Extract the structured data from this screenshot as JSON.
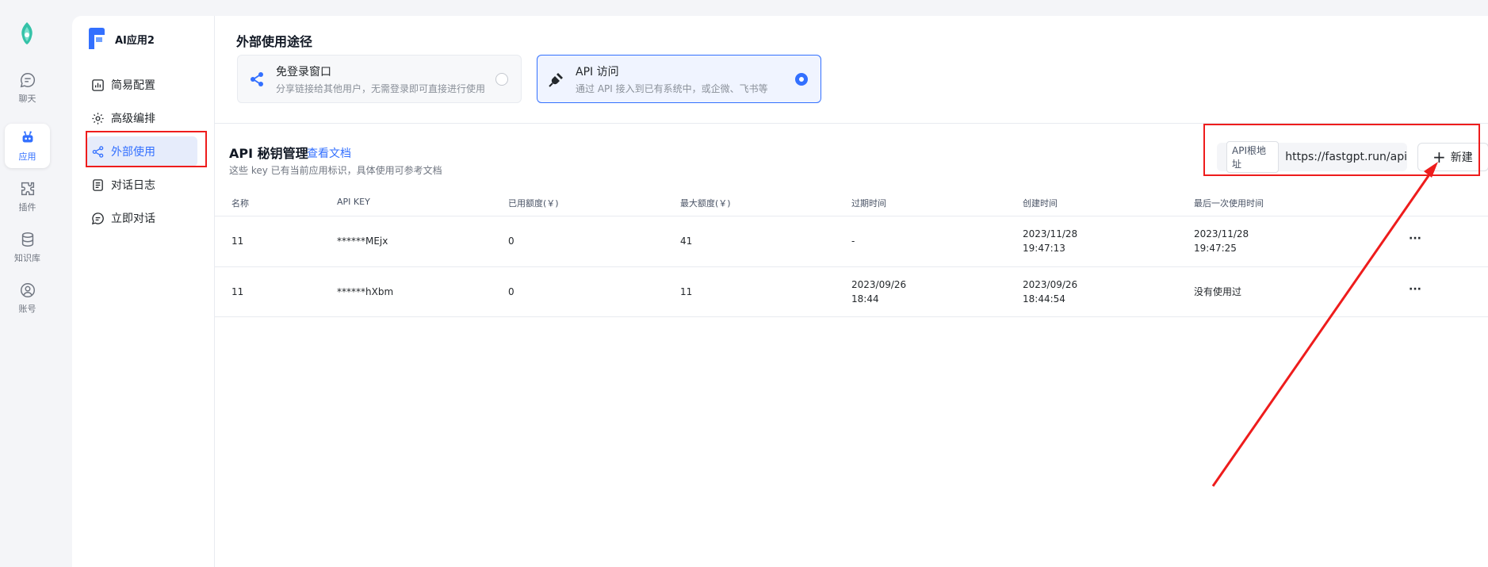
{
  "rail": {
    "items": [
      {
        "label": "聊天",
        "icon": "chat-icon"
      },
      {
        "label": "应用",
        "icon": "robot-icon"
      },
      {
        "label": "插件",
        "icon": "puzzle-icon"
      },
      {
        "label": "知识库",
        "icon": "database-icon"
      },
      {
        "label": "账号",
        "icon": "user-icon"
      }
    ]
  },
  "app": {
    "name": "AI应用2",
    "menu": [
      {
        "label": "简易配置",
        "icon": "chart-icon"
      },
      {
        "label": "高级编排",
        "icon": "gear-icon"
      },
      {
        "label": "外部使用",
        "icon": "share-icon"
      },
      {
        "label": "对话日志",
        "icon": "log-icon"
      },
      {
        "label": "立即对话",
        "icon": "chat-icon"
      }
    ]
  },
  "usage": {
    "section_title": "外部使用途径",
    "cards": [
      {
        "title": "免登录窗口",
        "desc": "分享链接给其他用户，无需登录即可直接进行使用",
        "icon": "share-icon",
        "selected": false
      },
      {
        "title": "API 访问",
        "desc": "通过 API 接入到已有系统中，或企微、飞书等",
        "icon": "plug-icon",
        "selected": true
      }
    ]
  },
  "api": {
    "title": "API 秘钥管理",
    "doc_link": "查看文档",
    "subtitle": "这些 key 已有当前应用标识，具体使用可参考文档",
    "base_url_label": "API根地址",
    "base_url": "https://fastgpt.run/api",
    "new_button": "新建",
    "columns": [
      "名称",
      "API KEY",
      "已用额度(￥)",
      "最大额度(￥)",
      "过期时间",
      "创建时间",
      "最后一次使用时间"
    ],
    "rows": [
      {
        "name": "11",
        "key": "******MEjx",
        "used": "0",
        "max": "41",
        "expire_1": "-",
        "expire_2": "",
        "created_1": "2023/11/28",
        "created_2": "19:47:13",
        "last_1": "2023/11/28",
        "last_2": "19:47:25"
      },
      {
        "name": "11",
        "key": "******hXbm",
        "used": "0",
        "max": "11",
        "expire_1": "2023/09/26",
        "expire_2": "18:44",
        "created_1": "2023/09/26",
        "created_2": "18:44:54",
        "last_1": "没有使用过",
        "last_2": ""
      }
    ],
    "row_menu_label": "···"
  },
  "colors": {
    "accent": "#3370ff",
    "annotation": "#ee1c1c"
  }
}
